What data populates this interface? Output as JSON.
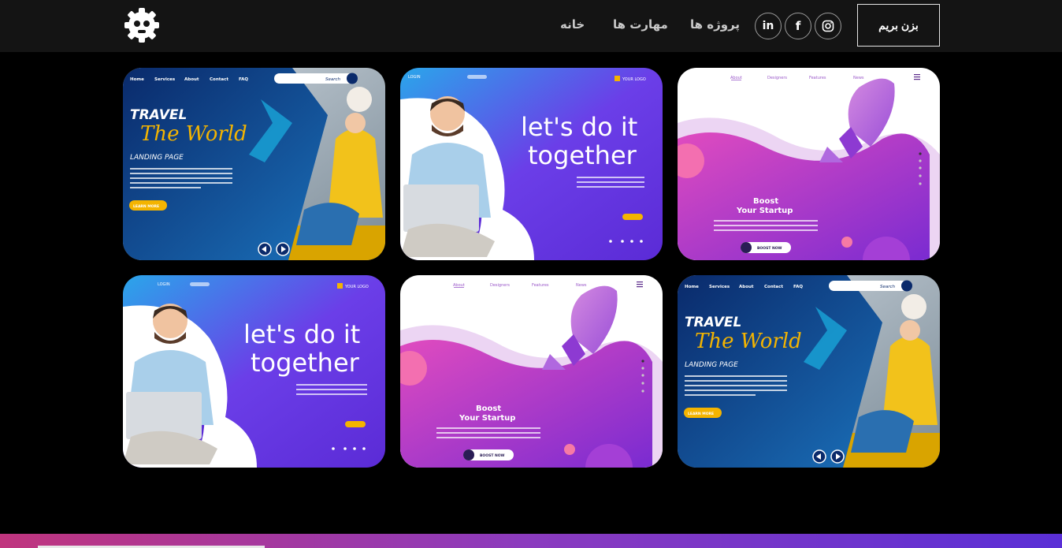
{
  "header": {
    "nav": [
      {
        "label": "خانه"
      },
      {
        "label": "مهارت ها"
      },
      {
        "label": "پروژه ها"
      }
    ],
    "social": [
      {
        "icon": "linkedin-icon",
        "glyph": "in"
      },
      {
        "icon": "facebook-icon",
        "glyph": "f"
      },
      {
        "icon": "instagram-icon",
        "glyph": "◎"
      }
    ],
    "cta_label": "بزن بریم"
  },
  "cards": {
    "travel": {
      "nav": [
        "Home",
        "Services",
        "About",
        "Contact",
        "FAQ"
      ],
      "search": "Search",
      "title1": "TRAVEL",
      "title2": "The World",
      "subtitle": "LANDING PAGE",
      "button": "LEARN MORE"
    },
    "together": {
      "login": "LOGIN",
      "logo": "YOUR LOGO",
      "line1": "let's do it",
      "line2": "together"
    },
    "boost": {
      "nav": [
        "About",
        "Designers",
        "Features",
        "News"
      ],
      "line1": "Boost",
      "line2": "Your Startup",
      "button": "BOOST NOW"
    }
  },
  "colors": {
    "header_bg": "#141414",
    "page_bg": "#000000",
    "accent_yellow": "#f4b400",
    "gradient_pink": "#c0357e",
    "gradient_purple": "#5a2fd6"
  }
}
